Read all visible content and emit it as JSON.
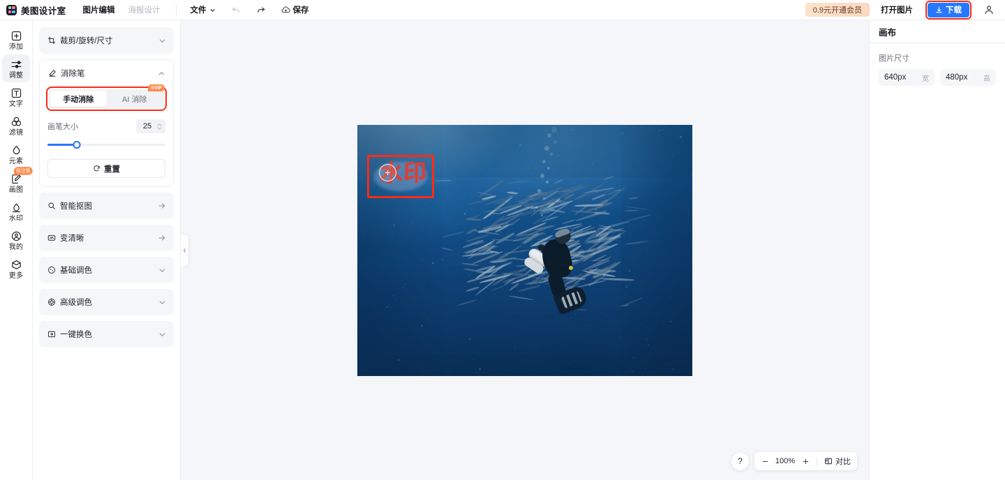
{
  "header": {
    "logo_text": "美图设计室",
    "nav": [
      {
        "label": "图片编辑",
        "active": true
      },
      {
        "label": "海报设计",
        "active": false
      }
    ],
    "file_menu": "文件",
    "undo_icon": "undo-icon",
    "redo_icon": "redo-icon",
    "save_label": "保存",
    "save_icon": "cloud-save-icon",
    "vip_label": "0.9元开通会员",
    "open_image_label": "打开图片",
    "download_label": "下载",
    "download_icon": "download-icon",
    "avatar_icon": "user-avatar-icon",
    "download_highlight_color": "#ff2a15",
    "download_bg_color": "#2878ff"
  },
  "rail": {
    "items": [
      {
        "label": "添加",
        "icon": "plus-square-icon",
        "active": false,
        "badge": null
      },
      {
        "label": "调整",
        "icon": "sliders-icon",
        "active": true,
        "badge": null
      },
      {
        "label": "文字",
        "icon": "text-box-icon",
        "active": false,
        "badge": null
      },
      {
        "label": "滤镜",
        "icon": "filter-circles-icon",
        "active": false,
        "badge": null
      },
      {
        "label": "元素",
        "icon": "shapes-icon",
        "active": false,
        "badge": null
      },
      {
        "label": "画图",
        "icon": "draw-pen-icon",
        "active": false,
        "badge": "标注笔"
      },
      {
        "label": "水印",
        "icon": "watermark-icon",
        "active": false,
        "badge": null
      },
      {
        "label": "我的",
        "icon": "account-icon",
        "active": false,
        "badge": null
      },
      {
        "label": "更多",
        "icon": "more-box-icon",
        "active": false,
        "badge": null
      }
    ]
  },
  "panel": {
    "crop_card": {
      "title": "裁剪/旋转/尺寸",
      "icon": "crop-icon",
      "chevron": "chevron-down"
    },
    "eraser_card": {
      "title": "消除笔",
      "icon": "eraser-pen-icon",
      "chevron": "chevron-up",
      "tabs": [
        {
          "label": "手动消除",
          "active": true,
          "badge": null
        },
        {
          "label": "AI 消除",
          "active": false,
          "badge": "SVIP"
        }
      ],
      "brush_size_label": "画笔大小",
      "brush_size_value": "25",
      "brush_slider_percent": 25,
      "reset_label": "重置",
      "reset_icon": "refresh-icon",
      "highlight_color": "#ff2a15"
    },
    "items": [
      {
        "title": "智能抠图",
        "icon": "magic-cutout-icon",
        "chevron": "arrow-right"
      },
      {
        "title": "变清晰",
        "icon": "enhance-icon",
        "chevron": "arrow-right"
      },
      {
        "title": "基础调色",
        "icon": "basic-color-icon",
        "chevron": "chevron-down"
      },
      {
        "title": "高级调色",
        "icon": "advanced-color-icon",
        "chevron": "chevron-down"
      },
      {
        "title": "一键换色",
        "icon": "recolor-icon",
        "chevron": "chevron-down"
      }
    ]
  },
  "canvas": {
    "collapse_icon": "chevron-left-icon",
    "watermark_text": "水印",
    "watermark_color": "#e8392c",
    "selection_color": "#ff2a15",
    "brush_cursor_icon": "brush-crosshair-icon",
    "image_alt": "underwater scuba diver with school of barracuda"
  },
  "bottom": {
    "help_label": "?",
    "zoom_out_icon": "minus-icon",
    "zoom_in_icon": "plus-icon",
    "zoom_value": "100%",
    "compare_label": "对比",
    "compare_icon": "compare-icon"
  },
  "right": {
    "title": "画布",
    "section_label": "图片尺寸",
    "width_value": "640px",
    "width_unit": "宽",
    "height_value": "480px",
    "height_unit": "高"
  }
}
